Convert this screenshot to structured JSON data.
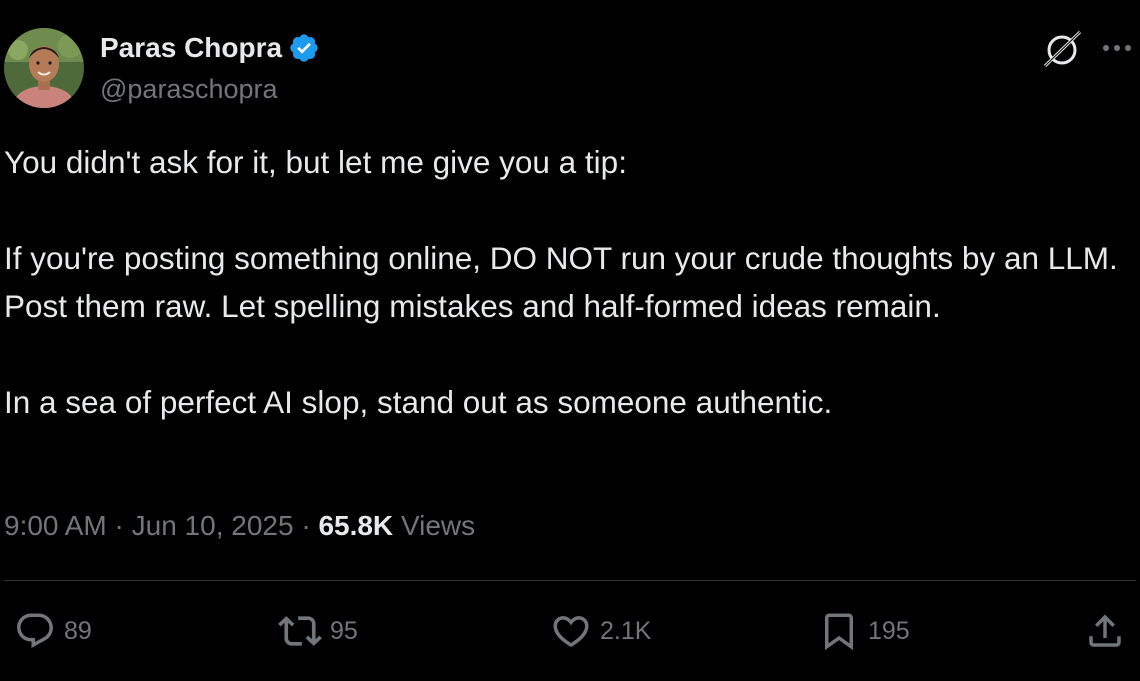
{
  "author": {
    "name": "Paras Chopra",
    "handle": "@paraschopra",
    "verified": true
  },
  "tweet": {
    "paragraphs": [
      "You didn't ask for it, but let me give you a tip:",
      "If you're posting something online, DO NOT run your crude thoughts by an LLM. Post them raw. Let spelling mistakes and half-formed ideas remain.",
      "In a sea of perfect AI slop, stand out as someone authentic."
    ],
    "time": "9:00 AM",
    "separator": "·",
    "date": "Jun 10, 2025",
    "views_count": "65.8K",
    "views_label": "Views"
  },
  "actions": {
    "replies": "89",
    "retweets": "95",
    "likes": "2.1K",
    "bookmarks": "195"
  },
  "icons": {
    "verified": "verified-badge-icon",
    "grok": "grok-icon",
    "more": "more-icon",
    "reply": "reply-icon",
    "retweet": "retweet-icon",
    "like": "heart-icon",
    "bookmark": "bookmark-icon",
    "share": "share-icon"
  },
  "colors": {
    "background": "#000000",
    "text": "#e7e9ea",
    "secondary": "#71767b",
    "verified": "#1d9bf0",
    "divider": "#2f3336"
  }
}
